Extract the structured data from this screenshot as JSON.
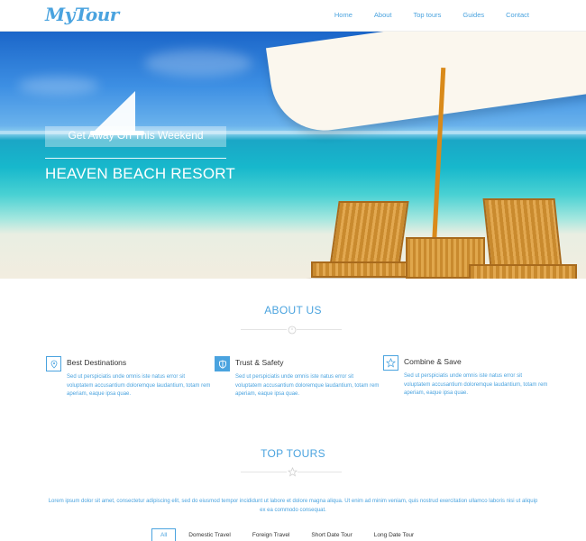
{
  "header": {
    "logo": "MyTour",
    "nav": [
      "Home",
      "About",
      "Top tours",
      "Guides",
      "Contact"
    ]
  },
  "hero": {
    "promo": "Get Away On This Weekend",
    "title": "HEAVEN BEACH RESORT"
  },
  "about": {
    "title": "ABOUT US",
    "features": [
      {
        "title": "Best Destinations",
        "icon": "map-pin-icon",
        "text": "Sed ut perspiciatis unde omnis iste natus error sit voluptatem accusantium doloremque laudantium, totam rem aperiam, eaque ipsa quae."
      },
      {
        "title": "Trust & Safety",
        "icon": "shield-icon",
        "text": "Sed ut perspiciatis unde omnis iste natus error sit voluptatem accusantium doloremque laudantium, totam rem aperiam, eaque ipsa quae."
      },
      {
        "title": "Combine & Save",
        "icon": "star-icon",
        "text": "Sed ut perspiciatis unde omnis iste natus error sit voluptatem accusantium doloremque laudantium, totam rem aperiam, eaque ipsa quae."
      }
    ]
  },
  "tours": {
    "title": "TOP TOURS",
    "description": "Lorem ipsum dolor sit amet, consectetur adipiscing elit, sed do eiusmod tempor incididunt ut labore et dolore magna aliqua. Ut enim ad minim veniam, quis nostrud exercitation ullamco laboris nisi ut aliquip ex ea commodo consequat.",
    "tabs": [
      "All",
      "Domestic Travel",
      "Foreign Travel",
      "Short Date Tour",
      "Long Date Tour"
    ],
    "active_tab": "All"
  },
  "colors": {
    "accent": "#4aa3df"
  }
}
